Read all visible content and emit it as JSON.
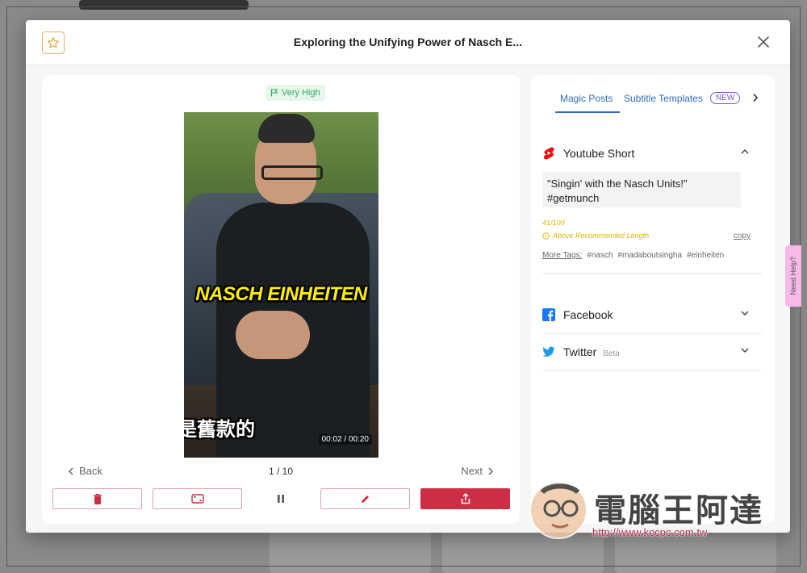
{
  "modal": {
    "title": "Exploring the Unifying Power of Nasch E...",
    "icons": {
      "star": "star-outline-icon",
      "close": "close-icon"
    }
  },
  "video_panel": {
    "rating_badge": "Very High",
    "video": {
      "caption_overlay": "NASCH EINHEITEN",
      "subtitle_overlay": "是舊款的",
      "timestamp": "00:02 / 00:20"
    },
    "nav": {
      "back_label": "Back",
      "counter": "1 / 10",
      "next_label": "Next"
    },
    "actions": [
      {
        "name": "delete",
        "icon": "trash-icon"
      },
      {
        "name": "resize",
        "icon": "aspect-ratio-icon"
      },
      {
        "name": "pause",
        "icon": "pause-icon"
      },
      {
        "name": "edit",
        "icon": "pencil-icon"
      },
      {
        "name": "share",
        "icon": "share-upload-icon"
      }
    ]
  },
  "side_panel": {
    "tabs": [
      {
        "label": "Magic Posts",
        "active": true
      },
      {
        "label": "Subtitle Templates",
        "badge": "NEW",
        "active": false
      }
    ],
    "platforms": [
      {
        "name": "Youtube Short",
        "icon": "youtube-shorts-icon",
        "expanded": true,
        "post_text": "\"Singin' with the Nasch Units!\" #getmunch",
        "length_count": "41/100",
        "copy_label": "copy",
        "length_warning": "Above Recommended Length",
        "more_tags_label": "More Tags:",
        "tags": [
          "#nasch",
          "#madaboutsingha",
          "#einheiten"
        ]
      },
      {
        "name": "Facebook",
        "icon": "facebook-icon",
        "expanded": false
      },
      {
        "name": "Twitter",
        "icon": "twitter-icon",
        "badge": "Beta",
        "expanded": false
      }
    ]
  },
  "need_help_tab": "Need Help?",
  "watermark": {
    "title": "電腦王阿達",
    "url": "http://www.kocpc.com.tw"
  },
  "colors": {
    "accent_red": "#cc2f45",
    "link_blue": "#2b6fbf",
    "warning_yellow": "#e0b400",
    "badge_green": "#2fa866"
  }
}
